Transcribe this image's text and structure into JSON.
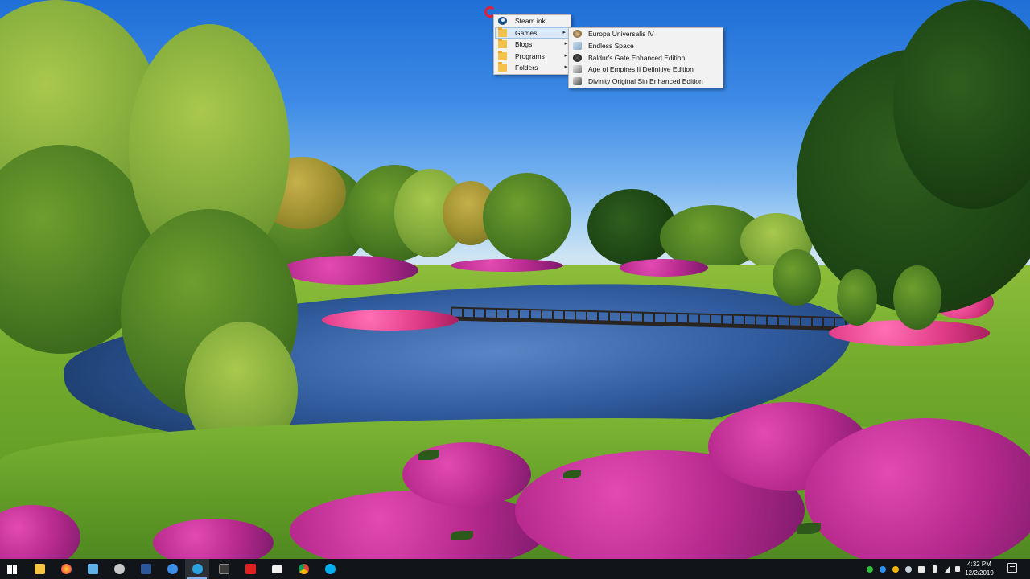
{
  "menu": {
    "items": [
      {
        "label": "Steam.ink",
        "icon": "steam-icon"
      },
      {
        "label": "Games",
        "icon": "folder-icon",
        "has_submenu": true,
        "selected": true
      },
      {
        "label": "Blogs",
        "icon": "folder-icon",
        "has_submenu": true
      },
      {
        "label": "Programs",
        "icon": "folder-icon",
        "has_submenu": true
      },
      {
        "label": "Folders",
        "icon": "folder-icon",
        "has_submenu": true
      }
    ],
    "submenu_arrow": "▸"
  },
  "submenu": {
    "items": [
      {
        "label": "Europa Universalis IV",
        "icon": "europa-universalis-icon"
      },
      {
        "label": "Endless Space",
        "icon": "endless-space-icon"
      },
      {
        "label": "Baldur's Gate Enhanced Edition",
        "icon": "baldurs-gate-icon"
      },
      {
        "label": "Age of Empires II Definitive Edition",
        "icon": "age-of-empires-icon"
      },
      {
        "label": "Divinity Original Sin Enhanced Edition",
        "icon": "divinity-icon"
      }
    ]
  },
  "taskbar": {
    "apps": [
      {
        "icon": "windows-start-icon"
      },
      {
        "icon": "file-explorer-icon",
        "color": "#f5c542"
      },
      {
        "icon": "firefox-icon",
        "color": "#ff7139"
      },
      {
        "icon": "notepad-icon",
        "color": "#5fb0e6"
      },
      {
        "icon": "chat-bubble-icon",
        "color": "#c8c8c8"
      },
      {
        "icon": "word-icon",
        "color": "#2b579a"
      },
      {
        "icon": "app-window-icon",
        "color": "#3a8ee6"
      },
      {
        "icon": "telegram-icon",
        "color": "#2aa1e0",
        "active": true
      },
      {
        "icon": "terminal-icon",
        "color": "#3c3c3c"
      },
      {
        "icon": "puzzle-icon",
        "color": "#e02020"
      },
      {
        "icon": "mail-icon",
        "color": "#f0f0f0"
      },
      {
        "icon": "chrome-icon",
        "color": "#f4b400"
      },
      {
        "icon": "skype-icon",
        "color": "#00aff0"
      }
    ],
    "tray": [
      {
        "icon": "tray-green-shield-icon",
        "color": "#2fbf3a"
      },
      {
        "icon": "tray-blue-icon",
        "color": "#2d8ff0"
      },
      {
        "icon": "tray-chrome-icon",
        "color": "#f4b400"
      },
      {
        "icon": "tray-steam-icon",
        "color": "#c8d2dc"
      },
      {
        "icon": "tray-white-icon",
        "color": "#e8e8e8"
      },
      {
        "icon": "battery-icon",
        "color": "#e8e8e8"
      },
      {
        "icon": "network-icon",
        "color": "#e8e8e8"
      },
      {
        "icon": "volume-icon",
        "color": "#e8e8e8"
      }
    ],
    "time": "4:32 PM",
    "date": "12/2/2019"
  }
}
